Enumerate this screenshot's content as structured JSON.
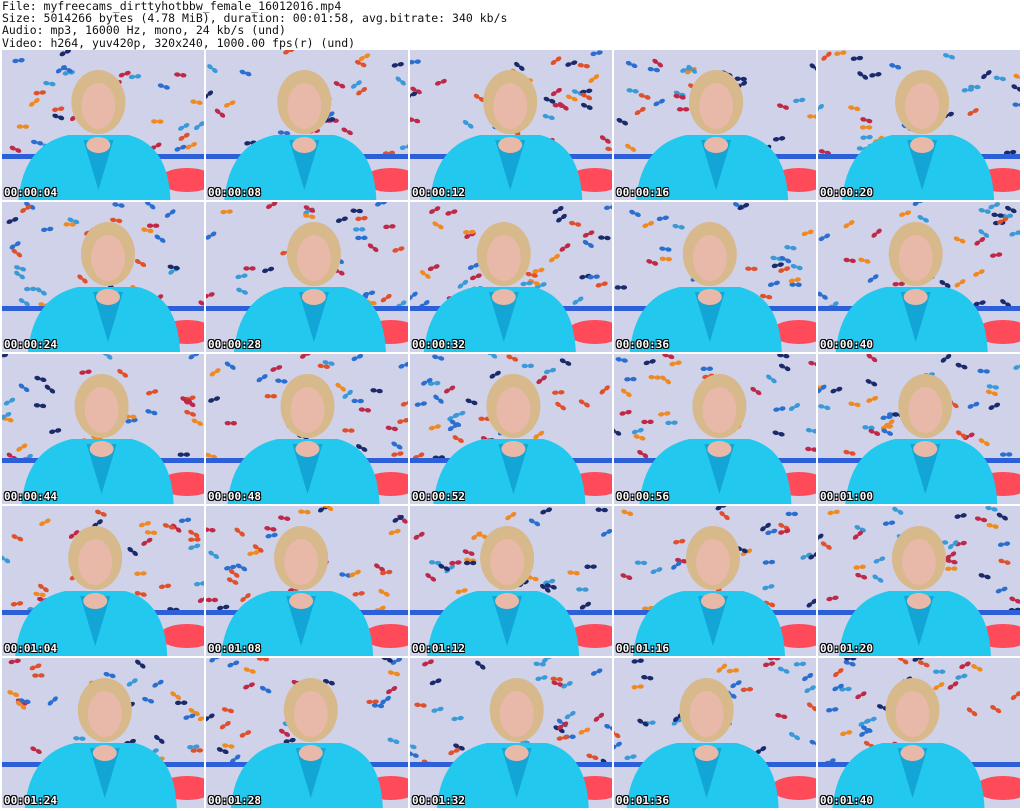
{
  "info": {
    "file": "File: myfreecams_dirttyhotbbw_female_16012016.mp4",
    "size": "Size: 5014266 bytes (4.78 MiB), duration: 00:01:58, avg.bitrate: 340 kb/s",
    "audio": "Audio: mp3, 16000 Hz, mono, 24 kb/s (und)",
    "video": "Video: h264, yuv420p, 320x240, 1000.00 fps(r) (und)"
  },
  "timestamps": [
    "00:00:04",
    "00:00:08",
    "00:00:12",
    "00:00:16",
    "00:00:20",
    "00:00:24",
    "00:00:28",
    "00:00:32",
    "00:00:36",
    "00:00:40",
    "00:00:44",
    "00:00:48",
    "00:00:52",
    "00:00:56",
    "00:01:00",
    "00:01:04",
    "00:01:08",
    "00:01:12",
    "00:01:16",
    "00:01:20",
    "00:01:24",
    "00:01:28",
    "00:01:32",
    "00:01:36",
    "00:01:40"
  ],
  "colors": {
    "wallpaper": "#cfd2e8",
    "robe": "#22c8ee",
    "robe_shadow": "#12a5d6",
    "hair": "#d7b98c",
    "skin": "#e8b8a8",
    "pillow": "#ff4a5a",
    "headboard": "#2c5fd8"
  }
}
